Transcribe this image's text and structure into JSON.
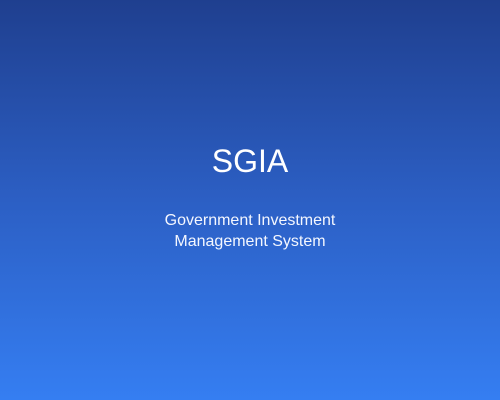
{
  "splash": {
    "title": "SGIA",
    "subtitle_lines": [
      "Government Investment",
      "Management System"
    ]
  },
  "colors": {
    "gradient_top": "#1f3f8f",
    "gradient_bottom": "#357ef2",
    "text": "#ffffff"
  }
}
